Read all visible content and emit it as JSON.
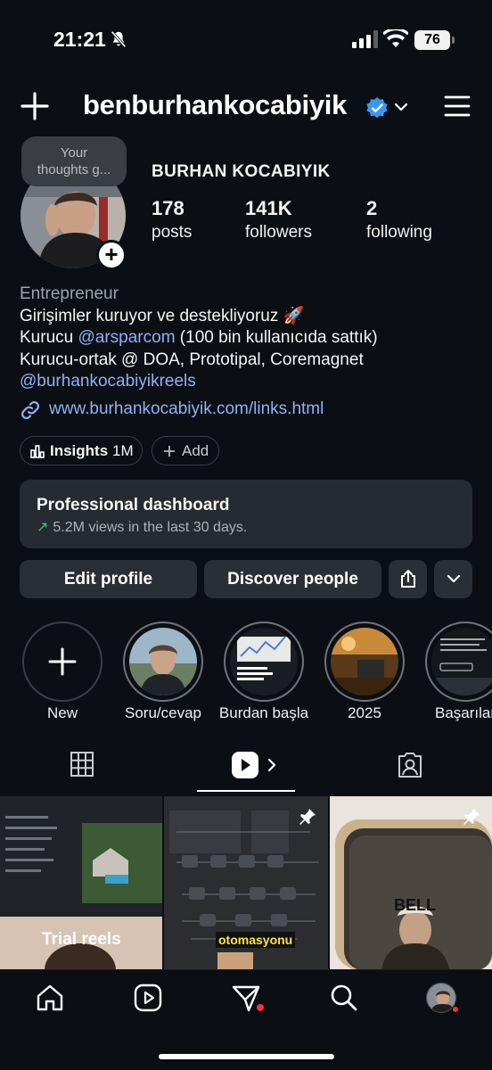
{
  "status_bar": {
    "time": "21:21",
    "battery": "76"
  },
  "header": {
    "username": "benburhankocabiyik"
  },
  "profile": {
    "note": "Your thoughts g...",
    "full_name": "BURHAN KOCABIYIK",
    "stats": [
      {
        "value": "178",
        "label": "posts"
      },
      {
        "value": "141K",
        "label": "followers"
      },
      {
        "value": "2",
        "label": "following"
      }
    ]
  },
  "bio": {
    "category": "Entrepreneur",
    "line1": "Girişimler kuruyor ve destekliyoruz 🚀",
    "line2_prefix": "Kurucu ",
    "line2_mention": "@arsparcom",
    "line2_suffix": " (100 bin kullanıcıda sattık)",
    "line3": "Kurucu-ortak @ DOA, Prototipal, Coremagnet",
    "line4_mention": "@burhankocabiyikreels",
    "website": "www.burhankocabiyik.com/links.html"
  },
  "pills": {
    "insights_label": "Insights",
    "insights_count": "1M",
    "add_label": "Add"
  },
  "dashboard": {
    "title": "Professional dashboard",
    "subtitle": "5.2M views in the last 30 days."
  },
  "actions": {
    "edit": "Edit profile",
    "discover": "Discover people"
  },
  "highlights": [
    {
      "label": "New"
    },
    {
      "label": "Soru/cevap"
    },
    {
      "label": "Burdan başla"
    },
    {
      "label": "2025"
    },
    {
      "label": "Başarılar"
    }
  ],
  "grid": {
    "cell1_label": "Trial reels",
    "cell2_caption": "otomasyonu",
    "cell3_sign": "BELL"
  },
  "colors": {
    "background": "#0b0f14",
    "link": "#8fb2f5",
    "verified": "#3897f0",
    "notification": "#ff3040"
  }
}
